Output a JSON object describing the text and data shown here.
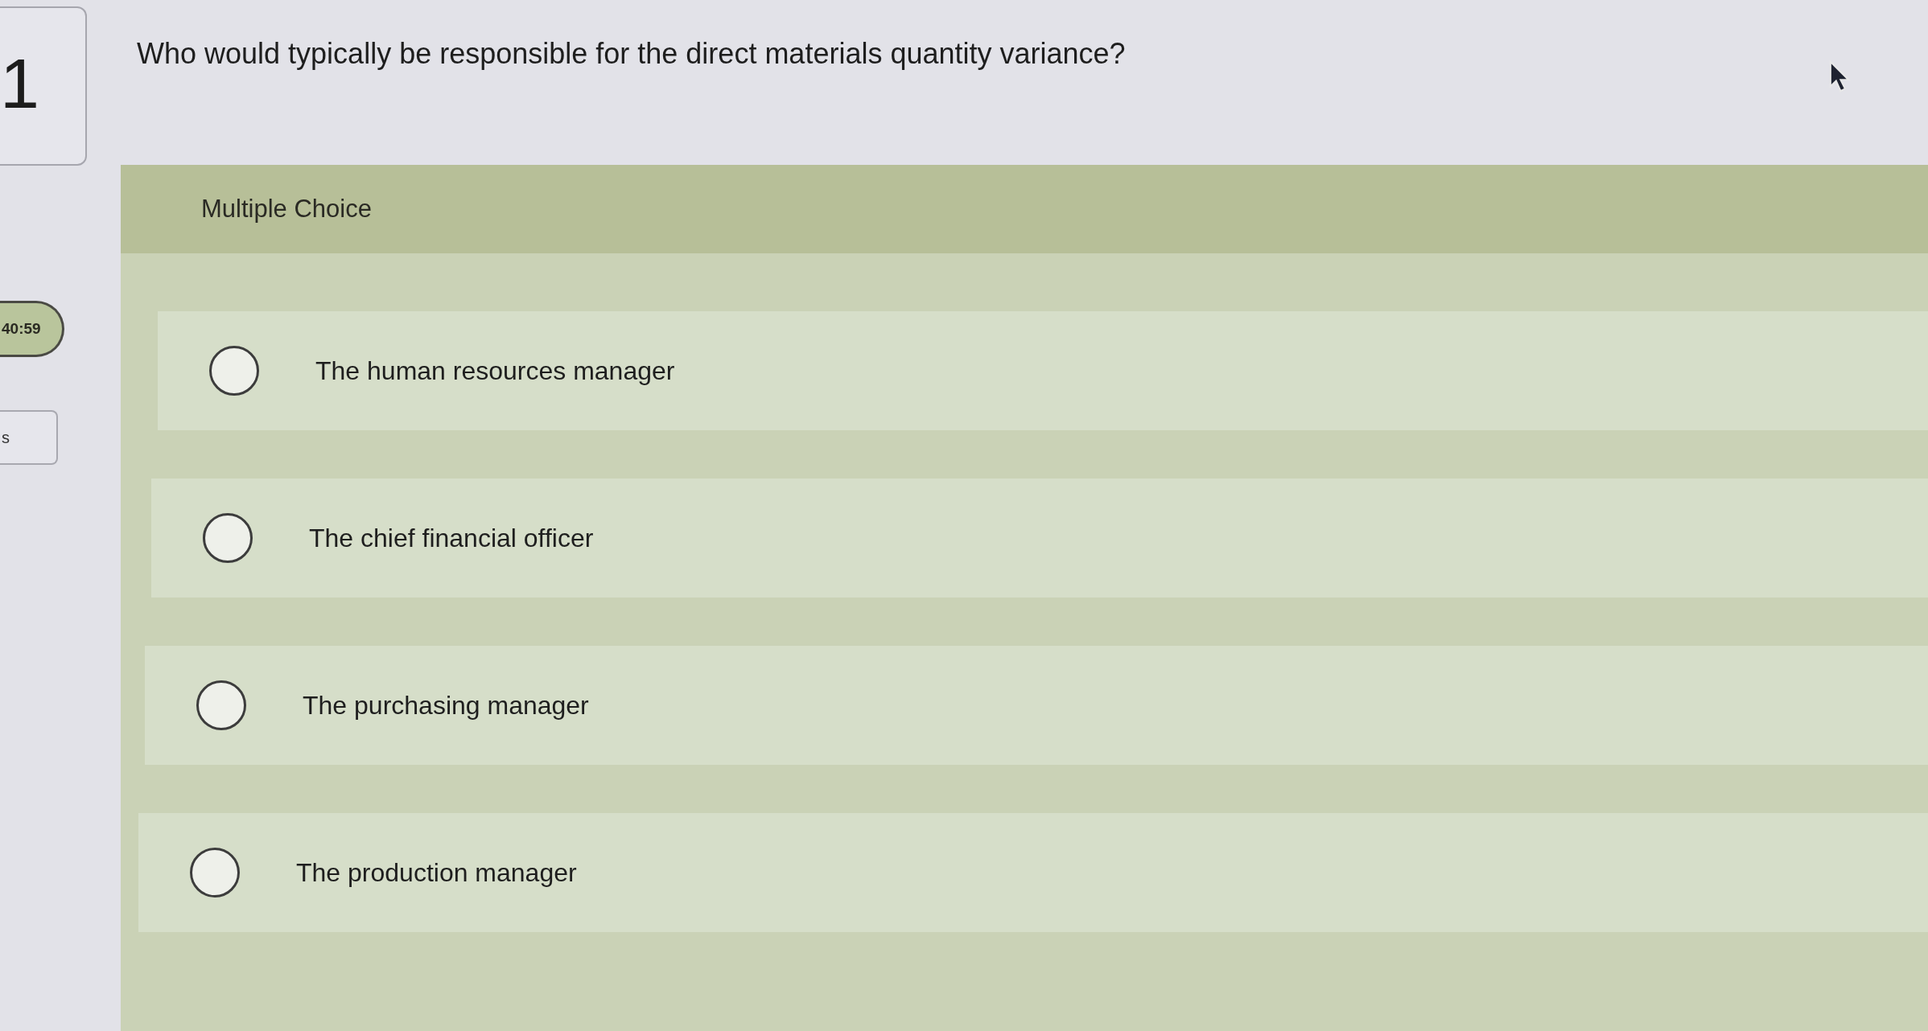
{
  "question_nav": {
    "number": "1"
  },
  "timer": {
    "time": "40:59"
  },
  "side_button": {
    "label": "s"
  },
  "question": {
    "text": "Who would typically be responsible for the direct materials quantity variance?"
  },
  "answer_panel": {
    "type_label": "Multiple Choice",
    "options": [
      {
        "label": "The human resources manager",
        "selected": false
      },
      {
        "label": "The chief financial officer",
        "selected": false
      },
      {
        "label": "The purchasing manager",
        "selected": false
      },
      {
        "label": "The production manager",
        "selected": false
      }
    ]
  }
}
